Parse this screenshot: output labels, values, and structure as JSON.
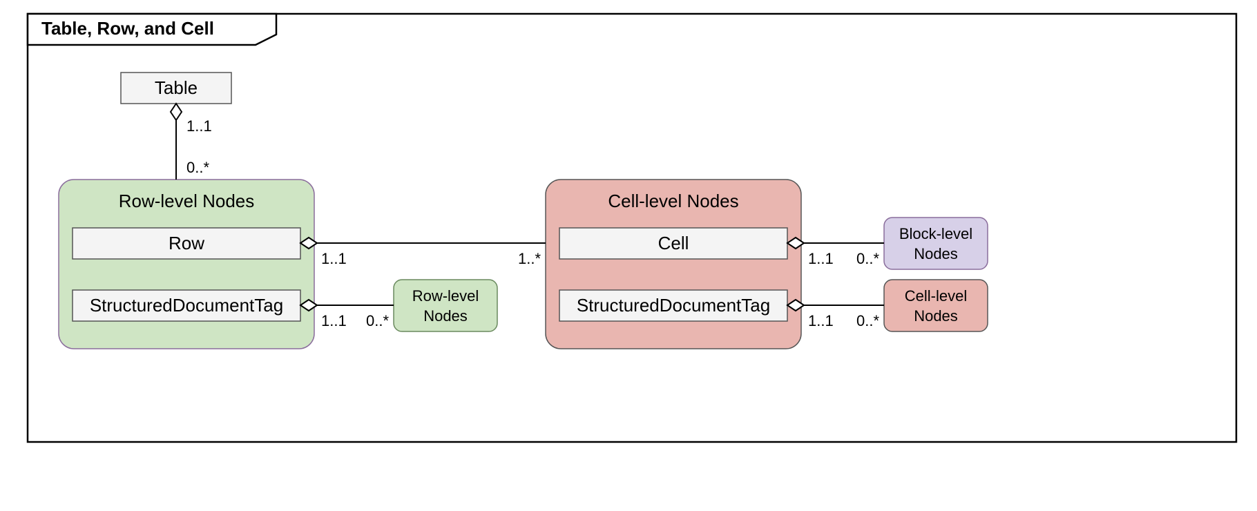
{
  "frame": {
    "title": "Table, Row, and Cell"
  },
  "nodes": {
    "table": "Table",
    "row_group_title": "Row-level Nodes",
    "row": "Row",
    "row_sdt": "StructuredDocumentTag",
    "row_level_small_l1": "Row-level",
    "row_level_small_l2": "Nodes",
    "cell_group_title": "Cell-level Nodes",
    "cell": "Cell",
    "cell_sdt": "StructuredDocumentTag",
    "block_level_small_l1": "Block-level",
    "block_level_small_l2": "Nodes",
    "cell_level_small_l1": "Cell-level",
    "cell_level_small_l2": "Nodes"
  },
  "mult": {
    "one_one": "1..1",
    "zero_star": "0..*",
    "one_star": "1..*"
  }
}
